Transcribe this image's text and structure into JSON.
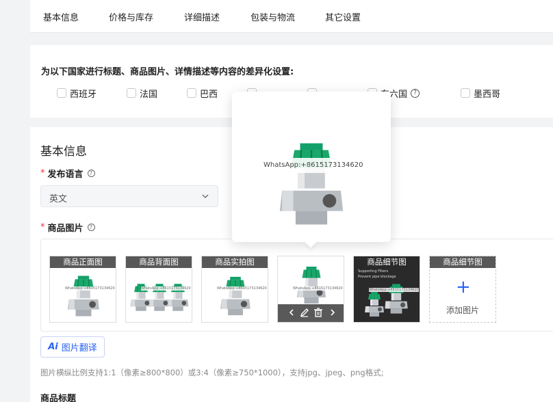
{
  "tabs": [
    "基本信息",
    "价格与库存",
    "详细描述",
    "包装与物流",
    "其它设置"
  ],
  "diff_settings": {
    "title": "为以下国家进行标题、商品图片、详情描述等内容的差异化设置:",
    "countries": [
      "西班牙",
      "法国",
      "巴西",
      "",
      "",
      "东六国",
      "墨西哥"
    ]
  },
  "basic_info": {
    "title": "基本信息",
    "language_label": "发布语言",
    "language_value": "英文",
    "images_label": "商品图片",
    "images": [
      {
        "title": "商品正面图"
      },
      {
        "title": "商品背面图"
      },
      {
        "title": "商品实拍图"
      },
      {
        "title": ""
      },
      {
        "title": "商品细节图"
      },
      {
        "title": "商品细节图"
      }
    ],
    "add_image": "添加图片",
    "translate_button": "图片翻译",
    "translate_ai": "Ai",
    "hint": "图片横纵比例支持1:1（像素≥800*800）或3:4（像素≥750*1000），支持jpg、jpeg、png格式;",
    "next_label": "商品标题"
  },
  "popover": {
    "watermark": "WhatsApp:+8615173134620"
  },
  "thumb_watermark": "WhatsApp:+8615173134620",
  "detail_texts": [
    "Supporting Filters",
    "Prevent pipe blockage"
  ],
  "icons": {
    "help": "help-circle-icon",
    "chevron": "chevron-down-icon",
    "plus": "plus-icon",
    "prev": "chevron-left-icon",
    "edit": "edit-icon",
    "delete": "delete-icon",
    "next": "chevron-right-icon"
  },
  "colors": {
    "accent": "#2a62f3",
    "required": "#e5353b",
    "valve_green": "#1aa86a"
  },
  "help_glyph": "?",
  "plus_glyph": "+",
  "required_mark": "*"
}
